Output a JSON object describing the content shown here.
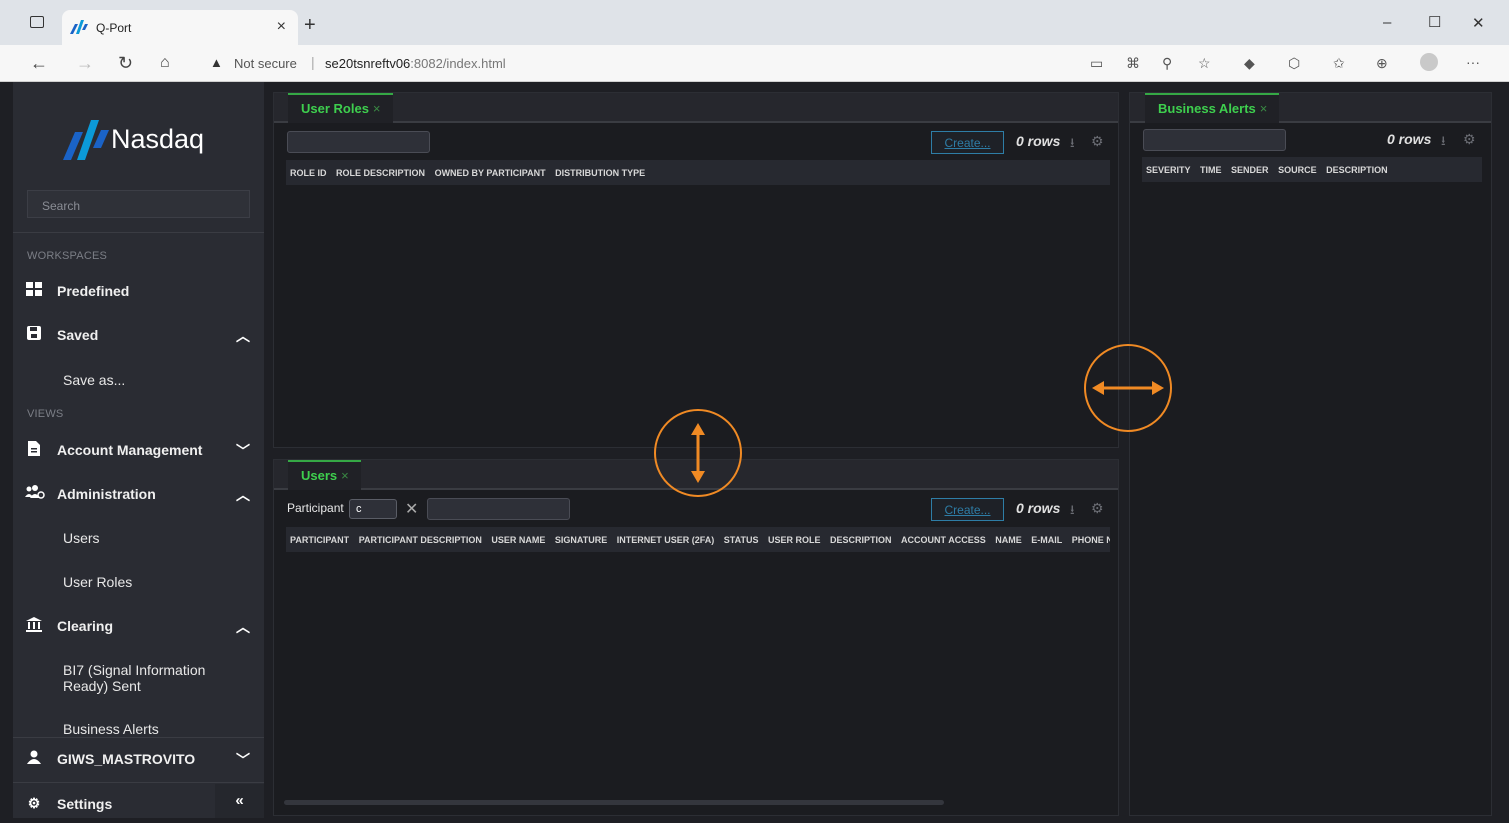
{
  "browser": {
    "tab_title": "Q-Port",
    "tab_close": "×",
    "new_tab": "+",
    "url_warning_icon": "▲",
    "url_status": "Not secure",
    "url_separator": "|",
    "url_host": "se20tsnreftv06",
    "url_path": ":8082/index.html",
    "minimize": "–",
    "maximize": "☐",
    "close": "✕",
    "more": "···"
  },
  "sidebar": {
    "logo_text": "Nasdaq",
    "search_placeholder": "Search",
    "workspaces_label": "WORKSPACES",
    "views_label": "VIEWS",
    "predefined": "Predefined",
    "saved": "Saved",
    "save_as": "Save as...",
    "account_management": "Account Management",
    "administration": "Administration",
    "users": "Users",
    "user_roles": "User Roles",
    "clearing": "Clearing",
    "bi7": "BI7 (Signal Information Ready) Sent",
    "business_alerts": "Business Alerts",
    "username": "GIWS_MASTROVITO",
    "settings": "Settings",
    "collapse": "«"
  },
  "user_roles_panel": {
    "tab": "User Roles",
    "tab_close": "×",
    "create": "Create...",
    "rows": "0 rows",
    "columns": [
      "ROLE ID",
      "ROLE DESCRIPTION",
      "OWNED BY PARTICIPANT",
      "DISTRIBUTION TYPE"
    ]
  },
  "users_panel": {
    "tab": "Users",
    "tab_close": "×",
    "participant_label": "Participant",
    "participant_value": "c",
    "clear": "✕",
    "create": "Create...",
    "rows": "0 rows",
    "columns": [
      "PARTICIPANT",
      "PARTICIPANT DESCRIPTION",
      "USER NAME",
      "SIGNATURE",
      "INTERNET USER (2FA)",
      "STATUS",
      "USER ROLE",
      "DESCRIPTION",
      "ACCOUNT ACCESS",
      "NAME",
      "E-MAIL",
      "PHONE N"
    ]
  },
  "business_alerts_panel": {
    "tab": "Business Alerts",
    "tab_close": "×",
    "rows": "0 rows",
    "columns": [
      "SEVERITY",
      "TIME",
      "SENDER",
      "SOURCE",
      "DESCRIPTION"
    ]
  },
  "colors": {
    "accent_green": "#3ecf4e",
    "create_blue": "#2e7da6",
    "annotation_orange": "#f08a24"
  }
}
